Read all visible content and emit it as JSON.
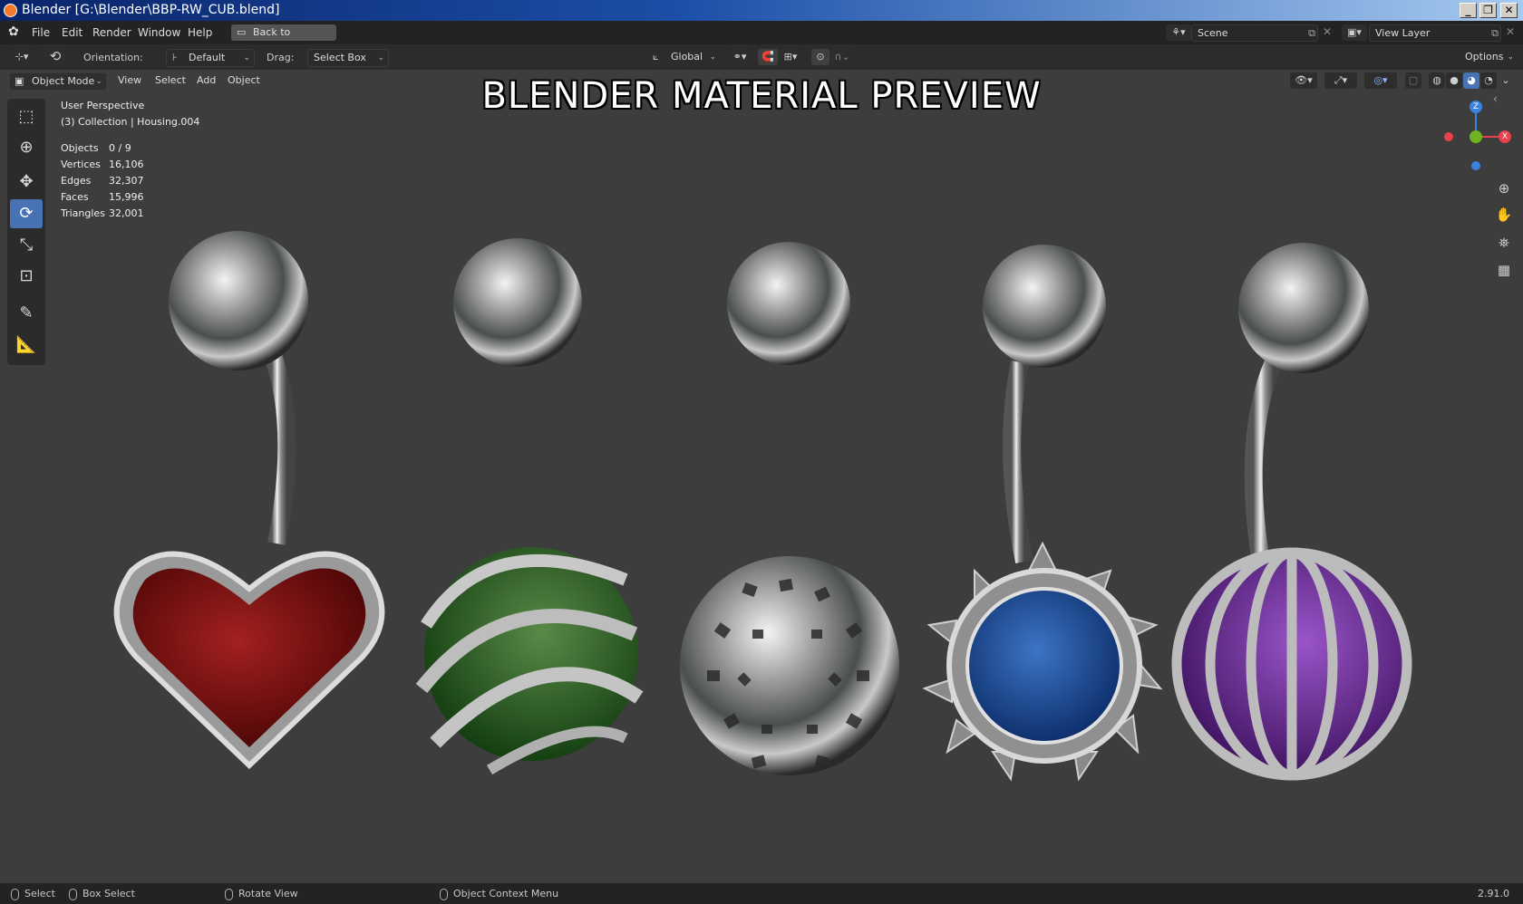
{
  "window": {
    "title": "Blender [G:\\Blender\\BBP-RW_CUB.blend]"
  },
  "menu": {
    "items": [
      "File",
      "Edit",
      "Render",
      "Window",
      "Help"
    ],
    "back_button": "Back to Previous",
    "scene_label": "Scene",
    "view_layer_label": "View Layer"
  },
  "tool_header": {
    "orientation_label": "Orientation:",
    "orientation_value": "Default",
    "drag_label": "Drag:",
    "drag_value": "Select Box",
    "transform_orientation": "Global",
    "options_label": "Options"
  },
  "viewport_header": {
    "mode": "Object Mode",
    "menus": [
      "View",
      "Select",
      "Add",
      "Object"
    ]
  },
  "overlay": {
    "perspective": "User Perspective",
    "collection": "(3) Collection | Housing.004",
    "title": "BLENDER MATERIAL PREVIEW",
    "stats": [
      {
        "label": "Objects",
        "value": "0 / 9"
      },
      {
        "label": "Vertices",
        "value": "16,106"
      },
      {
        "label": "Edges",
        "value": "32,307"
      },
      {
        "label": "Faces",
        "value": "15,996"
      },
      {
        "label": "Triangles",
        "value": "32,001"
      }
    ]
  },
  "gizmo": {
    "z": "Z",
    "x": "X",
    "colors": {
      "x": "#e8424f",
      "y": "#6fb321",
      "z": "#3b82e0"
    }
  },
  "gems": [
    {
      "name": "heart",
      "color": "#8a1010"
    },
    {
      "name": "swirl",
      "color": "#1f5a1c"
    },
    {
      "name": "filigree",
      "color": "#b8b8b8"
    },
    {
      "name": "sun",
      "color": "#1a4fa0"
    },
    {
      "name": "cage",
      "color": "#5a1f7a"
    }
  ],
  "statusbar": {
    "select": "Select",
    "box_select": "Box Select",
    "rotate_view": "Rotate View",
    "context_menu": "Object Context Menu",
    "version": "2.91.0"
  }
}
